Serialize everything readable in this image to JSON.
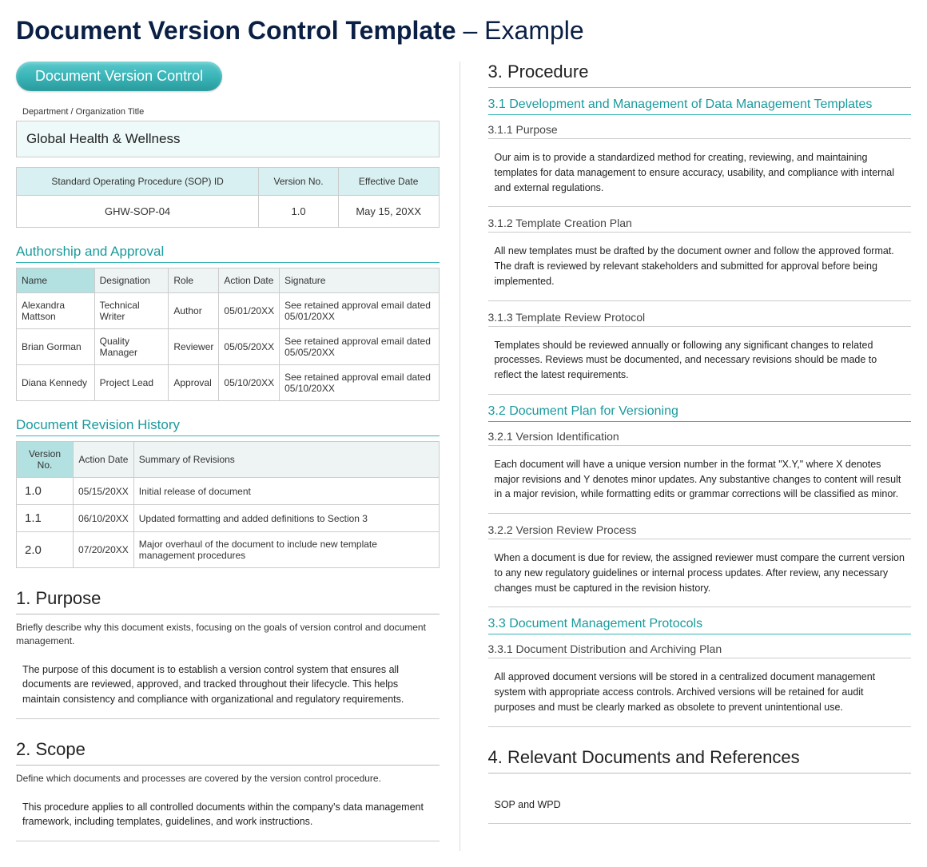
{
  "page_title_bold": "Document Version Control Template",
  "page_title_rest": " – Example",
  "pill_label": "Document Version Control",
  "dept_label": "Department / Organization Title",
  "org_name": "Global Health & Wellness",
  "meta": {
    "headers": [
      "Standard Operating Procedure (SOP) ID",
      "Version No.",
      "Effective Date"
    ],
    "values": [
      "GHW-SOP-04",
      "1.0",
      "May 15, 20XX"
    ]
  },
  "auth": {
    "title": "Authorship and Approval",
    "headers": [
      "Name",
      "Designation",
      "Role",
      "Action Date",
      "Signature"
    ],
    "rows": [
      {
        "name": "Alexandra Mattson",
        "desig": "Technical Writer",
        "role": "Author",
        "date": "05/01/20XX",
        "sig": "See retained approval email dated 05/01/20XX"
      },
      {
        "name": "Brian Gorman",
        "desig": "Quality Manager",
        "role": "Reviewer",
        "date": "05/05/20XX",
        "sig": "See retained approval email dated 05/05/20XX"
      },
      {
        "name": "Diana Kennedy",
        "desig": "Project Lead",
        "role": "Approval",
        "date": "05/10/20XX",
        "sig": "See retained approval email dated 05/10/20XX"
      }
    ]
  },
  "rev": {
    "title": "Document Revision History",
    "headers": [
      "Version No.",
      "Action Date",
      "Summary of Revisions"
    ],
    "rows": [
      {
        "ver": "1.0",
        "date": "05/15/20XX",
        "summary": "Initial release of document"
      },
      {
        "ver": "1.1",
        "date": "06/10/20XX",
        "summary": "Updated formatting and added definitions to Section 3"
      },
      {
        "ver": "2.0",
        "date": "07/20/20XX",
        "summary": "Major overhaul of the document to include new template management procedures"
      }
    ]
  },
  "sections": {
    "purpose": {
      "h": "1. Purpose",
      "desc": "Briefly describe why this document exists, focusing on the goals of version control and document management.",
      "body": "The purpose of this document is to establish a version control system that ensures all documents are reviewed, approved, and tracked throughout their lifecycle. This helps maintain consistency and compliance with organizational and regulatory requirements."
    },
    "scope": {
      "h": "2. Scope",
      "desc": "Define which documents and processes are covered by the version control procedure.",
      "body": "This procedure applies to all controlled documents within the company's data management framework, including templates, guidelines, and work instructions."
    },
    "procedure": {
      "h": "3. Procedure",
      "s31": {
        "h": "3.1 Development and Management of Data Management Templates",
        "p311_h": "3.1.1 Purpose",
        "p311_b": "Our aim is to provide a standardized method for creating, reviewing, and maintaining templates for data management to ensure accuracy, usability, and compliance with internal and external regulations.",
        "p312_h": "3.1.2 Template Creation Plan",
        "p312_b": "All new templates must be drafted by the document owner and follow the approved format. The draft is reviewed by relevant stakeholders and submitted for approval before being implemented.",
        "p313_h": "3.1.3 Template Review Protocol",
        "p313_b": "Templates should be reviewed annually or following any significant changes to related processes. Reviews must be documented, and necessary revisions should be made to reflect the latest requirements."
      },
      "s32": {
        "h": "3.2 Document Plan for Versioning",
        "p321_h": "3.2.1 Version Identification",
        "p321_b": "Each document will have a unique version number in the format \"X.Y,\" where X denotes major revisions and Y denotes minor updates. Any substantive changes to content will result in a major revision, while formatting edits or grammar corrections will be classified as minor.",
        "p322_h": "3.2.2 Version Review Process",
        "p322_b": "When a document is due for review, the assigned reviewer must compare the current version to any new regulatory guidelines or internal process updates. After review, any necessary changes must be captured in the revision history."
      },
      "s33": {
        "h": "3.3 Document Management Protocols",
        "p331_h": "3.3.1 Document Distribution and Archiving Plan",
        "p331_b": "All approved document versions will be stored in a centralized document management system with appropriate access controls. Archived versions will be retained for audit purposes and must be clearly marked as obsolete to prevent unintentional use."
      }
    },
    "refs": {
      "h": "4. Relevant Documents and References",
      "body": "SOP and WPD"
    }
  }
}
